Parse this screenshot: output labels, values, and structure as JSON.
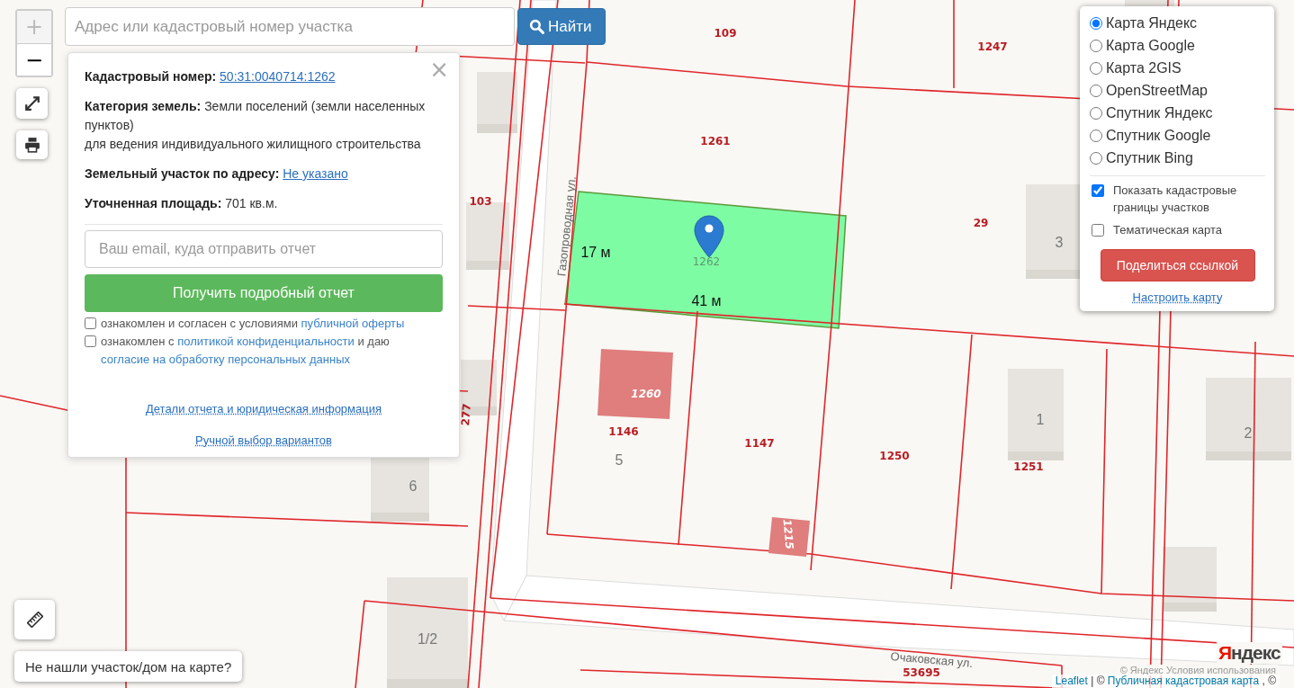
{
  "search": {
    "placeholder": "Адрес или кадастровый номер участка",
    "button": "Найти"
  },
  "zoom_controls": [
    {
      "label": "+",
      "disabled": true
    },
    {
      "label": "−",
      "disabled": false
    }
  ],
  "popup": {
    "close": "×",
    "fields": [
      {
        "label": "Кадастровый номер:",
        "value": "50:31:0040714:1262",
        "kind": "link"
      },
      {
        "label": "Категория земель:",
        "value": "Земли поселений (земли населенных пунктов)",
        "kind": "text",
        "note": "для ведения индивидуального жилищного строительства"
      },
      {
        "label": "Земельный участок по адресу:",
        "value": "Не указано",
        "kind": "link"
      },
      {
        "label": "Уточненная площадь:",
        "value": "701 кв.м.",
        "kind": "text"
      }
    ],
    "email_placeholder": "Ваш email, куда отправить отчет",
    "report_button": "Получить подробный отчет",
    "consents": [
      {
        "checked": false,
        "parts": [
          {
            "text": "ознакомлен и согласен с условиями",
            "kind": "text"
          },
          {
            "text": "публичной оферты",
            "kind": "link"
          }
        ]
      },
      {
        "checked": false,
        "parts": [
          {
            "text": "ознакомлен с",
            "kind": "text"
          },
          {
            "text": "политикой конфиденциальности",
            "kind": "link"
          },
          {
            "text": "и даю",
            "kind": "text"
          },
          {
            "text": "согласие на обработку персональных данных",
            "kind": "link"
          }
        ]
      }
    ],
    "links": [
      "Детали отчета и юридическая информация",
      "Ручной выбор вариантов"
    ]
  },
  "layers": {
    "base": [
      {
        "label": "Карта Яндекс",
        "selected": true
      },
      {
        "label": "Карта Google",
        "selected": false
      },
      {
        "label": "Карта 2GIS",
        "selected": false
      },
      {
        "label": "OpenStreetMap",
        "selected": false
      },
      {
        "label": "Спутник Яндекс",
        "selected": false
      },
      {
        "label": "Спутник Google",
        "selected": false
      },
      {
        "label": "Спутник Bing",
        "selected": false
      }
    ],
    "overlays": [
      {
        "label": "Показать кадастровые границы участков",
        "checked": true
      },
      {
        "label": "Тематическая карта",
        "checked": false
      }
    ],
    "share_button": "Поделиться ссылкой",
    "settings_link": "Настроить карту"
  },
  "map": {
    "parcel_labels": [
      {
        "text": "109",
        "kind": "parcel"
      },
      {
        "text": "1247",
        "kind": "parcel"
      },
      {
        "text": "1261",
        "kind": "parcel"
      },
      {
        "text": "103",
        "kind": "parcel"
      },
      {
        "text": "29",
        "kind": "parcel"
      },
      {
        "text": "1262",
        "kind": "selected"
      },
      {
        "text": "1260",
        "kind": "building"
      },
      {
        "text": "277",
        "kind": "parcel"
      },
      {
        "text": "1146",
        "kind": "parcel"
      },
      {
        "text": "1147",
        "kind": "parcel"
      },
      {
        "text": "1250",
        "kind": "parcel"
      },
      {
        "text": "1251",
        "kind": "parcel"
      },
      {
        "text": "1215",
        "kind": "building"
      },
      {
        "text": "53695",
        "kind": "parcel"
      }
    ],
    "house_numbers": [
      "3",
      "1",
      "2",
      "5",
      "6",
      "1/2"
    ],
    "streets": [
      "Газопроводная ул.",
      "Очаковская ул."
    ],
    "measurements": [
      "17 м",
      "41 м"
    ],
    "logo": "Яндекс",
    "provider_note": "© Яндекс Условия использования"
  },
  "not_found_button": "Не нашли участок/дом на карте?",
  "attribution": [
    {
      "text": "Leaflet",
      "kind": "link"
    },
    {
      "text": "|  ©",
      "kind": "text"
    },
    {
      "text": "Публичная кадастровая карта",
      "kind": "link"
    },
    {
      "text": ", ©",
      "kind": "text"
    }
  ]
}
